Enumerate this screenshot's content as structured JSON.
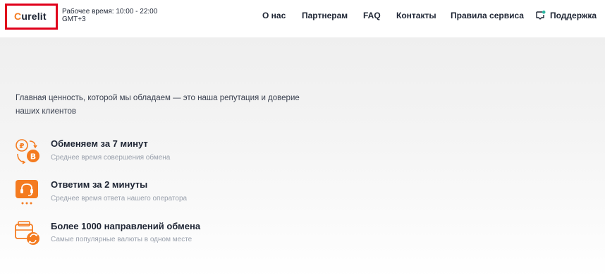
{
  "header": {
    "logo_first": "C",
    "logo_rest": "urelit",
    "hours_line1": "Рабочее время: 10:00 - 22:00",
    "hours_line2": "GMT+3",
    "nav": {
      "about": "О нас",
      "partners": "Партнерам",
      "faq": "FAQ",
      "contacts": "Контакты",
      "rules": "Правила сервиса",
      "support": "Поддержка"
    }
  },
  "hero": {
    "tagline": "Главная ценность, которой мы обладаем — это наша репутация и доверие наших клиентов",
    "features": [
      {
        "title": "Обменяем за 7 минут",
        "subtitle": "Среднее время совершения обмена",
        "icon": "ruble-bitcoin-exchange-icon"
      },
      {
        "title": "Ответим за 2 минуты",
        "subtitle": "Среднее время ответа нашего оператора",
        "icon": "operator-headset-icon"
      },
      {
        "title": "Более 1000 направлений обмена",
        "subtitle": "Самые популярные валюты в одном месте",
        "icon": "wallet-exchange-icon"
      }
    ]
  },
  "colors": {
    "accent": "#f47b20",
    "highlight_box": "#e0001b",
    "text_dark": "#1d2433",
    "text_muted": "#9aa1ad"
  }
}
